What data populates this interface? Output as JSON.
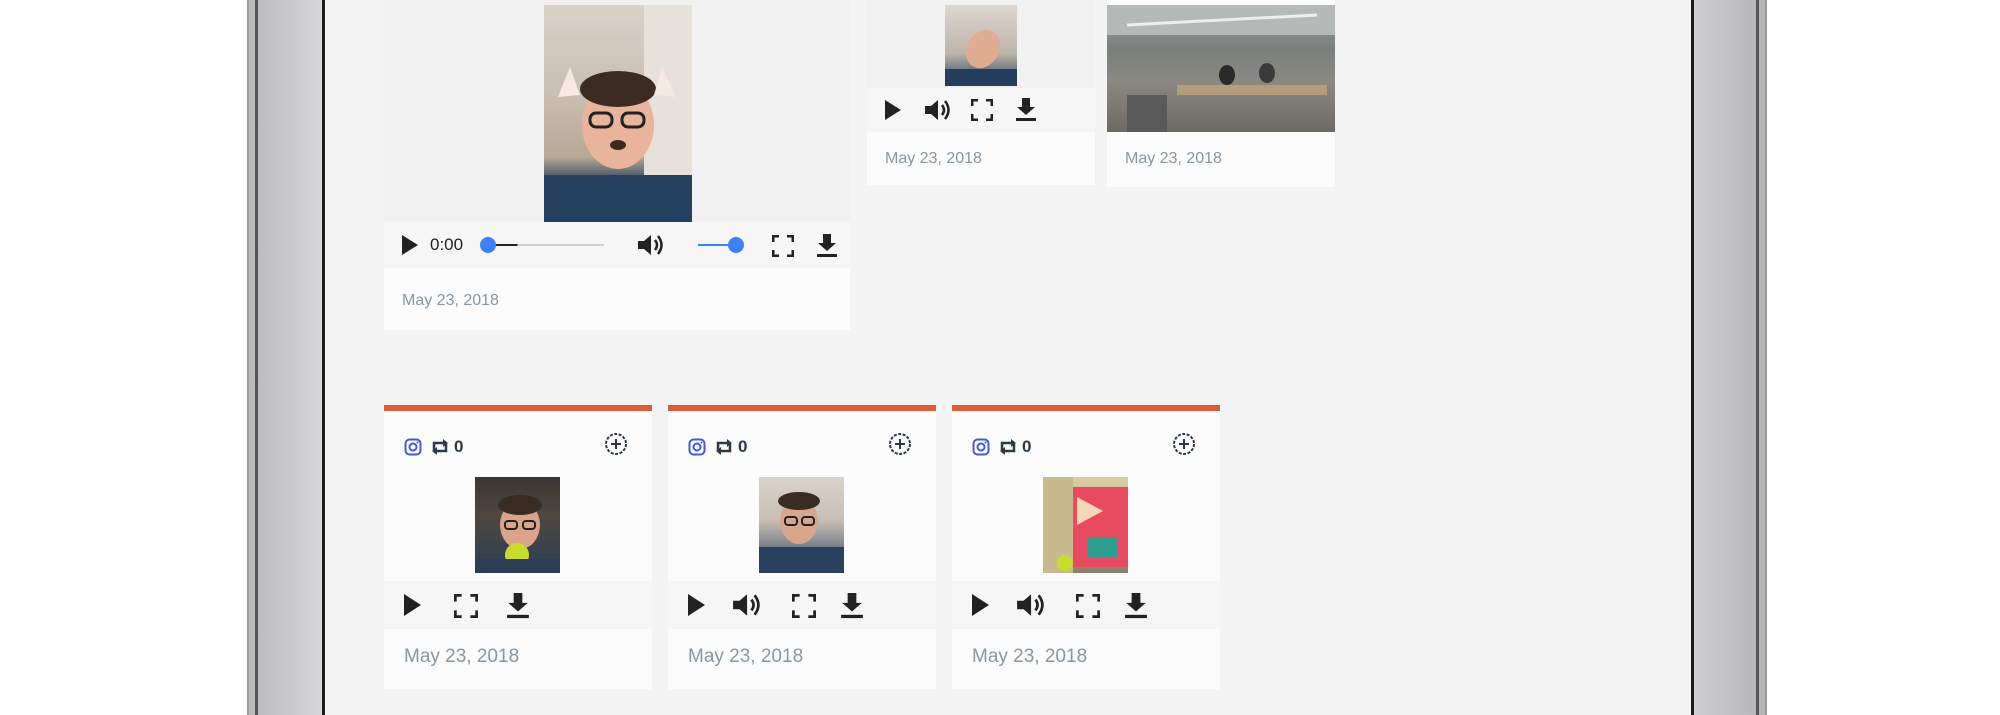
{
  "top_cards": [
    {
      "time": "0:00",
      "date": "May 23, 2018"
    },
    {
      "date": "May 23, 2018"
    },
    {
      "date": "May 23, 2018"
    }
  ],
  "bottom_cards": [
    {
      "repost_count": "0",
      "date": "May 23, 2018",
      "has_volume": false
    },
    {
      "repost_count": "0",
      "date": "May 23, 2018",
      "has_volume": true
    },
    {
      "repost_count": "0",
      "date": "May 23, 2018",
      "has_volume": true
    }
  ],
  "icons": {
    "play": "play-icon",
    "volume": "volume-icon",
    "fullscreen": "fullscreen-icon",
    "download": "download-icon",
    "instagram": "instagram-icon",
    "repost": "repost-icon",
    "add": "add-circle-icon"
  },
  "colors": {
    "accent_bar": "#de5b3b",
    "slider_blue": "#3b82f6",
    "instagram_blue": "#3f5bd8",
    "date_text": "#8797a3"
  },
  "progress": {
    "seek_fraction": 0.25,
    "volume_fraction": 1.0
  }
}
